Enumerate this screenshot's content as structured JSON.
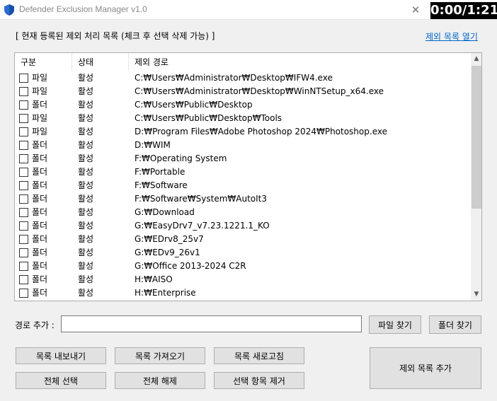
{
  "window": {
    "title": "Defender Exclusion Manager v1.0",
    "timer": "0:00/1:21"
  },
  "list": {
    "section_title": "[ 현재 등록된 제외 처리 목록 (체크 후 선택 삭제 가능) ]",
    "open_link": "제외 목록 열기",
    "columns": [
      "구분",
      "상태",
      "제외 경로"
    ],
    "rows": [
      {
        "type": "파일",
        "state": "활성",
        "path": "C:₩Users₩Administrator₩Desktop₩IFW4.exe"
      },
      {
        "type": "파일",
        "state": "활성",
        "path": "C:₩Users₩Administrator₩Desktop₩WinNTSetup_x64.exe"
      },
      {
        "type": "폴더",
        "state": "활성",
        "path": "C:₩Users₩Public₩Desktop"
      },
      {
        "type": "파일",
        "state": "활성",
        "path": "C:₩Users₩Public₩Desktop₩Tools"
      },
      {
        "type": "파일",
        "state": "활성",
        "path": "D:₩Program Files₩Adobe Photoshop 2024₩Photoshop.exe"
      },
      {
        "type": "폴더",
        "state": "활성",
        "path": "D:₩WIM"
      },
      {
        "type": "폴더",
        "state": "활성",
        "path": "F:₩Operating System"
      },
      {
        "type": "폴더",
        "state": "활성",
        "path": "F:₩Portable"
      },
      {
        "type": "폴더",
        "state": "활성",
        "path": "F:₩Software"
      },
      {
        "type": "폴더",
        "state": "활성",
        "path": "F:₩Software₩System₩AutoIt3"
      },
      {
        "type": "폴더",
        "state": "활성",
        "path": "G:₩Download"
      },
      {
        "type": "폴더",
        "state": "활성",
        "path": "G:₩EasyDrv7_v7.23.1221.1_KO"
      },
      {
        "type": "폴더",
        "state": "활성",
        "path": "G:₩EDrv8_25v7"
      },
      {
        "type": "폴더",
        "state": "활성",
        "path": "G:₩EDv9_26v1"
      },
      {
        "type": "폴더",
        "state": "활성",
        "path": "G:₩Office 2013-2024 C2R"
      },
      {
        "type": "폴더",
        "state": "활성",
        "path": "H:₩AISO"
      },
      {
        "type": "폴더",
        "state": "활성",
        "path": "H:₩Enterprise"
      }
    ]
  },
  "path_add": {
    "label": "경로 추가 :",
    "value": "",
    "file_button": "파일 찾기",
    "folder_button": "폴더 찾기"
  },
  "buttons": {
    "export": "목록 내보내기",
    "import": "목록 가져오기",
    "refresh": "목록 새로고침",
    "select_all": "전체 선택",
    "deselect_all": "전체 해제",
    "remove_selected": "선택 항목 제거",
    "add_exclusion": "제외 목록 추가"
  },
  "icons": {
    "app": "shield-icon",
    "close": "close-icon",
    "scroll_up": "scroll-up-icon",
    "scroll_down": "scroll-down-icon"
  },
  "colors": {
    "window_bg": "#f0f0f0",
    "link": "#0066cc",
    "button_bg": "#e1e1e1",
    "button_border": "#adadad",
    "app_icon_blue": "#2b6cd4"
  }
}
